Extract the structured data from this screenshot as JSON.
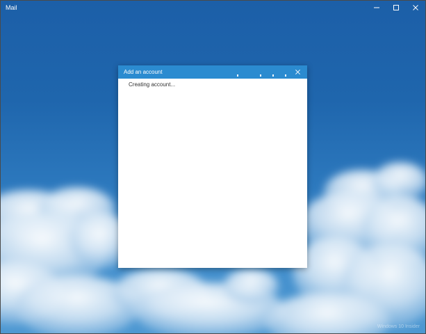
{
  "window": {
    "title": "Mail"
  },
  "window_controls": {
    "minimize_icon": "minimize-icon",
    "maximize_icon": "maximize-icon",
    "close_icon": "close-icon"
  },
  "dialog": {
    "title": "Add an account",
    "close_icon": "close-icon",
    "status_text": "Creating account...",
    "accent_color": "#2b8bd0"
  },
  "background": {
    "sky_color": "#1f66ad",
    "watermark": "Windows 10 Insider"
  }
}
